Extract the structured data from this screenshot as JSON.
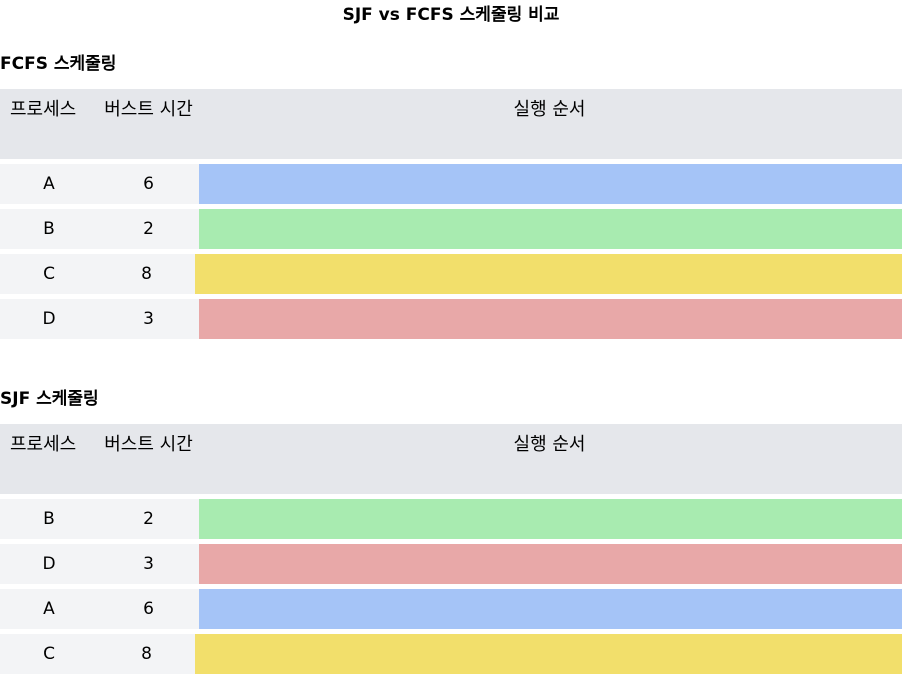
{
  "page_title": "SJF vs FCFS 스케줄링 비교",
  "headers": {
    "process": "프로세스",
    "burst": "버스트 시간",
    "order": "실행 순서"
  },
  "colors": {
    "A": "#a5c4f7",
    "B": "#a8ebb0",
    "C": "#f2df6b",
    "D": "#e8a8a8"
  },
  "fcfs": {
    "title": "FCFS 스케줄링",
    "rows": [
      {
        "process": "A",
        "burst": "6",
        "color": "#a5c4f7"
      },
      {
        "process": "B",
        "burst": "2",
        "color": "#a8ebb0"
      },
      {
        "process": "C",
        "burst": "8",
        "color": "#f2df6b"
      },
      {
        "process": "D",
        "burst": "3",
        "color": "#e8a8a8"
      }
    ]
  },
  "sjf": {
    "title": "SJF 스케줄링",
    "rows": [
      {
        "process": "B",
        "burst": "2",
        "color": "#a8ebb0"
      },
      {
        "process": "D",
        "burst": "3",
        "color": "#e8a8a8"
      },
      {
        "process": "A",
        "burst": "6",
        "color": "#a5c4f7"
      },
      {
        "process": "C",
        "burst": "8",
        "color": "#f2df6b"
      }
    ]
  }
}
